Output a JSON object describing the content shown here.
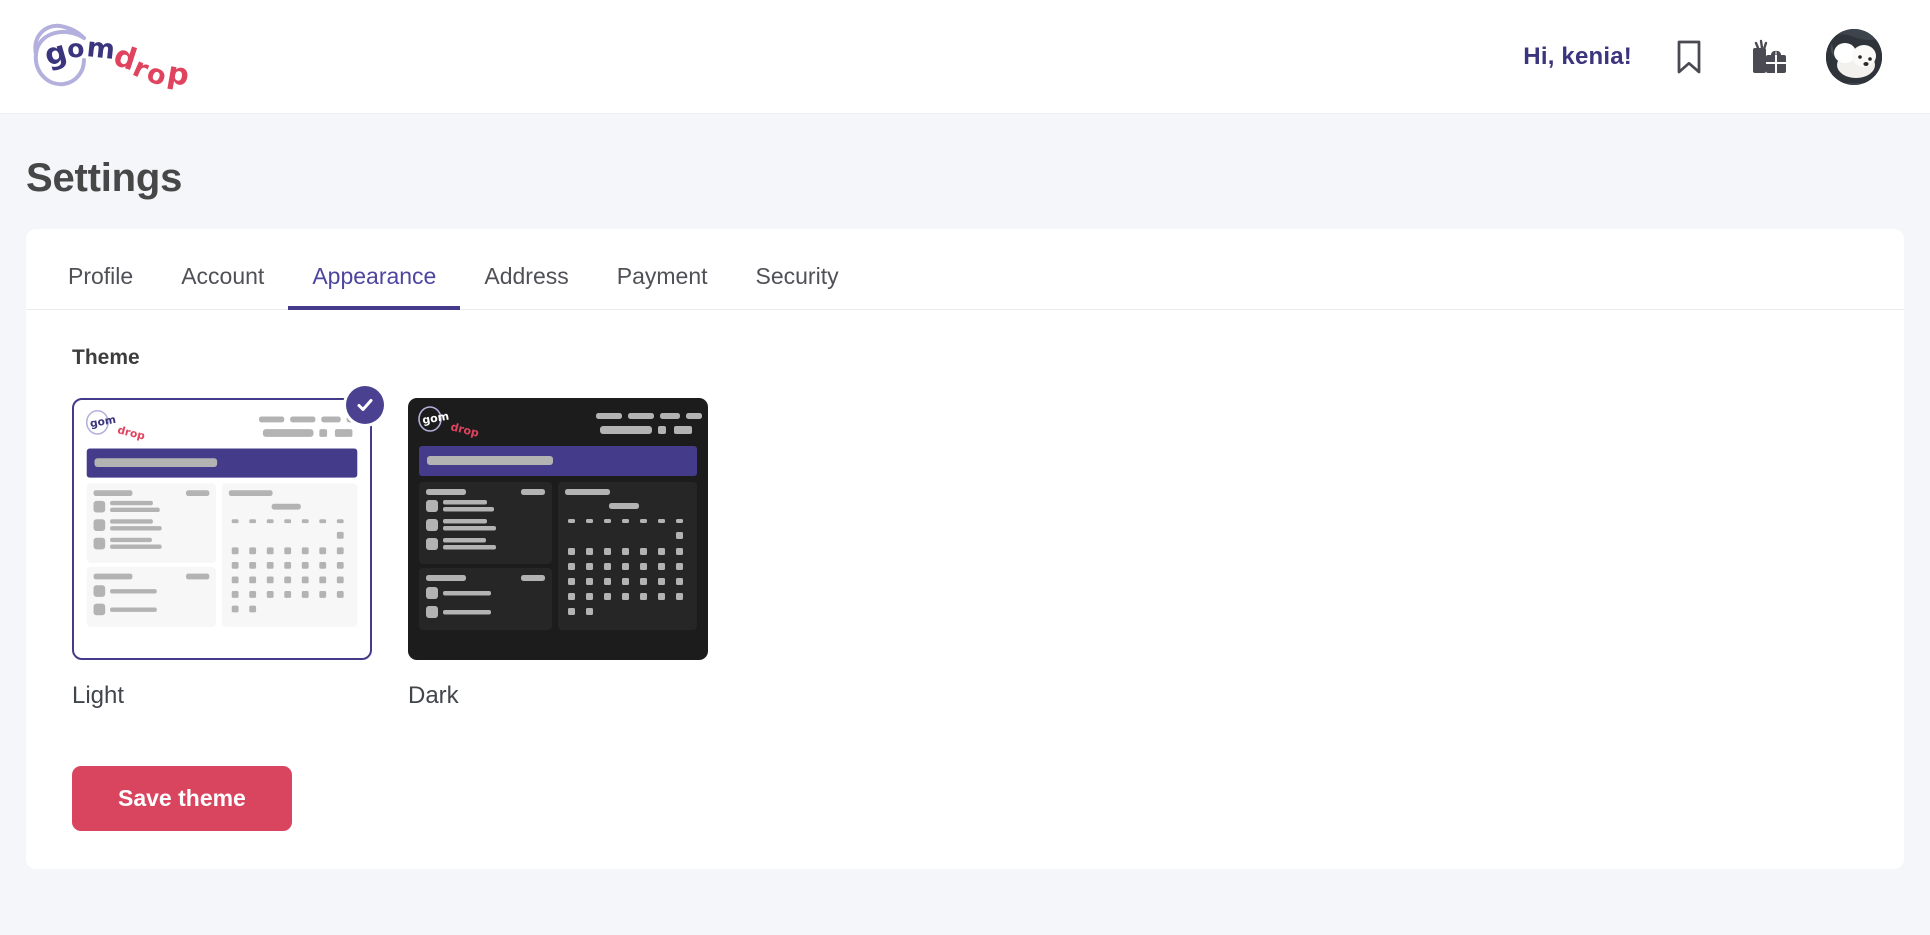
{
  "brand": {
    "name": "gomdrop",
    "word_1": "gom",
    "word_2": "drop",
    "color_primary": "#3b357e",
    "color_secondary": "#e0435e",
    "outline_color": "#b3b0dd"
  },
  "header": {
    "greeting": "Hi, kenia!",
    "icons": [
      {
        "name": "bookmark-icon",
        "label": "Bookmarks"
      },
      {
        "name": "gifts-icon",
        "label": "Gifts"
      }
    ],
    "avatar_alt": "User avatar"
  },
  "page": {
    "title": "Settings"
  },
  "tabs": [
    {
      "label": "Profile",
      "active": false
    },
    {
      "label": "Account",
      "active": false
    },
    {
      "label": "Appearance",
      "active": true
    },
    {
      "label": "Address",
      "active": false
    },
    {
      "label": "Payment",
      "active": false
    },
    {
      "label": "Security",
      "active": false
    }
  ],
  "appearance": {
    "section_title": "Theme",
    "options": [
      {
        "id": "light",
        "label": "Light",
        "selected": true
      },
      {
        "id": "dark",
        "label": "Dark",
        "selected": false
      }
    ],
    "save_label": "Save theme"
  },
  "colors": {
    "accent_purple": "#443c8a",
    "accent_pink": "#d9455f",
    "page_bg": "#f5f6f9",
    "card_bg": "#ffffff",
    "text_dark": "#474747",
    "dark_theme_bg": "#1c1c1c",
    "dark_theme_panel": "#262626",
    "skeleton_gray": "#b3b3b3"
  }
}
